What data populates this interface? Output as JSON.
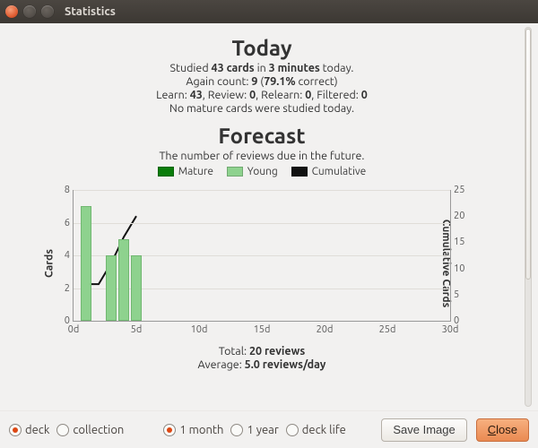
{
  "window": {
    "title": "Statistics"
  },
  "today": {
    "heading": "Today",
    "studied_prefix": "Studied ",
    "cards_count": "43 cards",
    "studied_mid": " in ",
    "minutes_count": "3 minutes",
    "studied_suffix": " today.",
    "again_prefix": "Again count: ",
    "again_count": "9",
    "again_paren_open": " (",
    "correct_pct": "79.1%",
    "again_paren_close": " correct)",
    "learn_label": "Learn: ",
    "learn_v": "43",
    "review_label": ", Review: ",
    "review_v": "0",
    "relearn_label": ", Relearn: ",
    "relearn_v": "0",
    "filtered_label": ", Filtered: ",
    "filtered_v": "0",
    "mature_none": "No mature cards were studied today."
  },
  "forecast": {
    "heading": "Forecast",
    "subtitle": "The number of reviews due in the future.",
    "legend": {
      "mature": "Mature",
      "young": "Young",
      "cumulative": "Cumulative"
    },
    "ylabel_left": "Cards",
    "ylabel_right": "Cumulative Cards",
    "total_prefix": "Total: ",
    "total_value": "20 reviews",
    "avg_prefix": "Average: ",
    "avg_value": "5.0 reviews/day"
  },
  "chart_data": {
    "type": "bar",
    "title": "Forecast",
    "xlabel": "",
    "ylabel": "Cards",
    "y2label": "Cumulative Cards",
    "x_ticks": [
      "0d",
      "5d",
      "10d",
      "15d",
      "20d",
      "25d",
      "30d"
    ],
    "y_ticks": [
      0,
      2,
      4,
      6,
      8
    ],
    "y2_ticks": [
      0,
      5,
      10,
      15,
      20,
      25
    ],
    "ylim": [
      0,
      8
    ],
    "y2lim": [
      0,
      25
    ],
    "grid": true,
    "legend": [
      "Mature",
      "Young",
      "Cumulative"
    ],
    "categories_days": [
      1,
      2,
      3,
      4,
      5
    ],
    "series": [
      {
        "name": "Mature",
        "values": [
          0,
          0,
          0,
          0,
          0
        ],
        "color": "#0a7d0a"
      },
      {
        "name": "Young",
        "values": [
          7,
          0,
          4,
          5,
          4
        ],
        "color": "#8ed28e"
      }
    ],
    "cumulative": {
      "name": "Cumulative",
      "values": [
        7,
        7,
        11,
        16,
        20
      ],
      "color": "#111"
    }
  },
  "footer": {
    "scope": {
      "deck": "deck",
      "collection": "collection",
      "selected": "deck"
    },
    "range": {
      "one_month": "1 month",
      "one_year": "1 year",
      "deck_life": "deck life",
      "selected": "one_month"
    },
    "save_image": "Save Image",
    "close": "Close"
  }
}
